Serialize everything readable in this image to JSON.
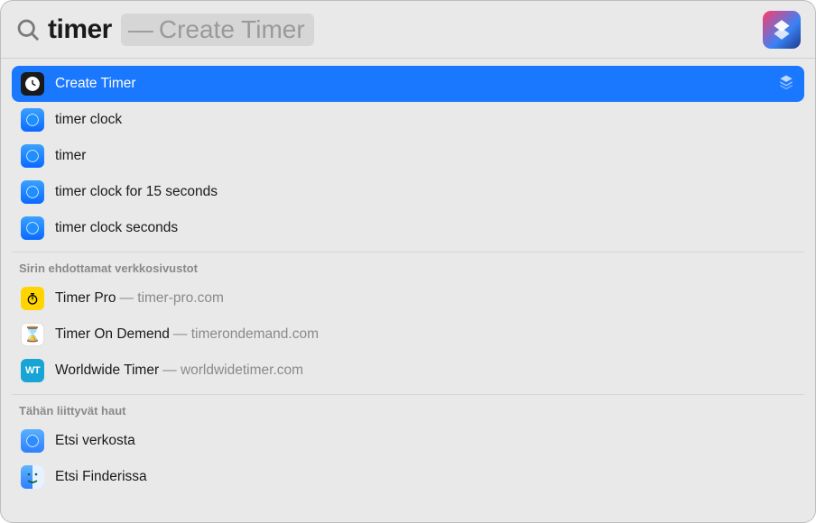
{
  "search": {
    "query": "timer",
    "suggestion_prefix": "—",
    "suggestion": "Create Timer"
  },
  "app_badge": "shortcuts-icon",
  "top_hit": {
    "label": "Create Timer"
  },
  "suggestions": [
    {
      "label": "timer clock"
    },
    {
      "label": "timer"
    },
    {
      "label": "timer clock for 15 seconds"
    },
    {
      "label": "timer clock seconds"
    }
  ],
  "sections": [
    {
      "header": "Sirin ehdottamat verkkosivustot",
      "items": [
        {
          "icon": "stopwatch",
          "title": "Timer Pro",
          "sub": " — timer-pro.com"
        },
        {
          "icon": "hourglass",
          "title": "Timer On Demend",
          "sub": " — timerondemand.com"
        },
        {
          "icon": "wt",
          "title": "Worldwide Timer",
          "sub": " — worldwidetimer.com"
        }
      ]
    },
    {
      "header": "Tähän liittyvät haut",
      "items": [
        {
          "icon": "safari",
          "title": "Etsi verkosta",
          "sub": ""
        },
        {
          "icon": "finder",
          "title": "Etsi Finderissa",
          "sub": ""
        }
      ]
    }
  ]
}
